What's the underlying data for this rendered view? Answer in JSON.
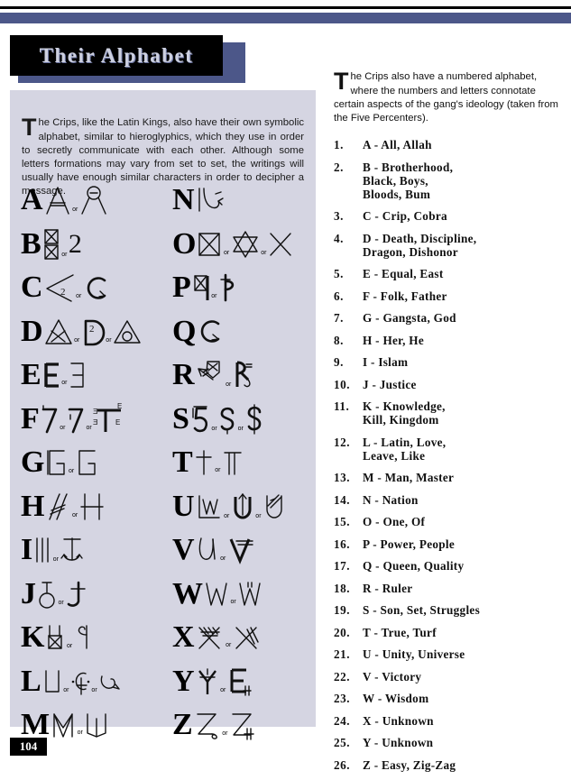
{
  "page": {
    "number": "104",
    "title": "Their Alphabet",
    "colors": {
      "rule_blue": "#4c5789",
      "rule_black": "#000000",
      "panel_lavender": "#d5d5e2",
      "title_plate": "#000000",
      "title_text": "#cdd0e0",
      "page_number_bg": "#000000",
      "page_number_text": "#ffffff"
    }
  },
  "left": {
    "intro": {
      "dropcap": "T",
      "body": "he Crips, like the Latin Kings, also have their own symbolic alphabet, similar to hieroglyphics, which they use in order to secretly communicate with each other. Although some letters formations may vary from set to set, the writings will usually have enough similar characters in order to decipher a message."
    },
    "or_label": "or",
    "alphabet": [
      {
        "letter": "A",
        "variants": [
          "triangle-with-crossbar",
          "circle-on-open-triangle"
        ]
      },
      {
        "letter": "B",
        "variants": [
          "stacked-crossed-boxes",
          "numeral-2"
        ]
      },
      {
        "letter": "C",
        "variants": [
          "open-wedge-with-2",
          "c-with-arrow"
        ]
      },
      {
        "letter": "D",
        "variants": [
          "triangle-with-x",
          "d-with-2"
        ],
        "extra": "triangle-with-circle"
      },
      {
        "letter": "E",
        "variants": [
          "bold-e-bar",
          "reversed-e"
        ]
      },
      {
        "letter": "F",
        "variants": [
          "numeral-7-tick",
          "numeral-7-tick-alt"
        ],
        "extra": "t-with-e-marks"
      },
      {
        "letter": "G",
        "variants": [
          "open-g-box",
          "open-g-box-alt"
        ]
      },
      {
        "letter": "H",
        "variants": [
          "slashed-h-script",
          "cross-bar-h"
        ]
      },
      {
        "letter": "I",
        "variants": [
          "double-bar-i",
          "anchor-i"
        ]
      },
      {
        "letter": "J",
        "variants": [
          "loop-j-circle",
          "crossed-j"
        ]
      },
      {
        "letter": "K",
        "variants": [
          "crossed-box-k",
          "hooked-y-k"
        ]
      },
      {
        "letter": "L",
        "variants": [
          "bracket-l",
          "c-with-cross-l"
        ],
        "extra": "curled-l-arrow"
      },
      {
        "letter": "M",
        "variants": [
          "angular-m",
          "open-m"
        ]
      },
      {
        "letter": "N",
        "variants": [
          "script-n-arrow"
        ]
      },
      {
        "letter": "O",
        "variants": [
          "crossed-box-o",
          "star-of-david"
        ],
        "extra": "x-cross"
      },
      {
        "letter": "P",
        "variants": [
          "crossed-box-p",
          "flag-p"
        ]
      },
      {
        "letter": "Q",
        "variants": [
          "c-with-arrow-q"
        ]
      },
      {
        "letter": "R",
        "variants": [
          "banner-arrow-x-r",
          "r-with-hook"
        ]
      },
      {
        "letter": "S",
        "variants": [
          "numeral-5-bar",
          "hooked-s"
        ],
        "extra": "dollar-s"
      },
      {
        "letter": "T",
        "variants": [
          "cross-t",
          "double-bar-t"
        ]
      },
      {
        "letter": "U",
        "variants": [
          "boxed-w-u",
          "u-with-arrow"
        ],
        "extra": "slashed-u"
      },
      {
        "letter": "V",
        "variants": [
          "script-u-v",
          "crossed-v"
        ]
      },
      {
        "letter": "W",
        "variants": [
          "thin-w",
          "open-w-tick"
        ]
      },
      {
        "letter": "X",
        "variants": [
          "multi-barb-x",
          "double-slash-x"
        ]
      },
      {
        "letter": "Y",
        "variants": [
          "barred-y",
          "e-with-bars"
        ]
      },
      {
        "letter": "Z",
        "variants": [
          "z-with-loop",
          "z-with-bars"
        ]
      }
    ]
  },
  "right": {
    "intro": {
      "dropcap": "T",
      "body": "he Crips also have a numbered alphabet, where the numbers and letters connotate certain aspects of the gang's ideology (taken from the Five Percenters)."
    },
    "items": [
      {
        "num": "1.",
        "text": "A - All, Allah"
      },
      {
        "num": "2.",
        "text": "B - Brotherhood,\nBlack, Boys,\nBloods, Bum"
      },
      {
        "num": "3.",
        "text": "C - Crip, Cobra"
      },
      {
        "num": "4.",
        "text": "D - Death, Discipline,\nDragon, Dishonor"
      },
      {
        "num": "5.",
        "text": "E - Equal, East"
      },
      {
        "num": "6.",
        "text": "F - Folk, Father"
      },
      {
        "num": "7.",
        "text": "G - Gangsta, God"
      },
      {
        "num": "8.",
        "text": "H - Her, He"
      },
      {
        "num": "9.",
        "text": "I - Islam"
      },
      {
        "num": "10.",
        "text": "J - Justice"
      },
      {
        "num": "11.",
        "text": "K - Knowledge,\nKill, Kingdom"
      },
      {
        "num": "12.",
        "text": "L - Latin, Love,\nLeave, Like"
      },
      {
        "num": "13.",
        "text": "M - Man, Master"
      },
      {
        "num": "14.",
        "text": "N - Nation"
      },
      {
        "num": "15.",
        "text": "O - One, Of"
      },
      {
        "num": "16.",
        "text": "P - Power, People"
      },
      {
        "num": "17.",
        "text": "Q - Queen, Quality"
      },
      {
        "num": "18.",
        "text": "R - Ruler"
      },
      {
        "num": "19.",
        "text": "S - Son, Set, Struggles"
      },
      {
        "num": "20.",
        "text": "T - True, Turf"
      },
      {
        "num": "21.",
        "text": "U - Unity, Universe"
      },
      {
        "num": "22.",
        "text": "V - Victory"
      },
      {
        "num": "23.",
        "text": "W - Wisdom"
      },
      {
        "num": "24.",
        "text": "X - Unknown"
      },
      {
        "num": "25.",
        "text": "Y - Unknown"
      },
      {
        "num": "26.",
        "text": "Z - Easy, Zig-Zag"
      }
    ]
  }
}
